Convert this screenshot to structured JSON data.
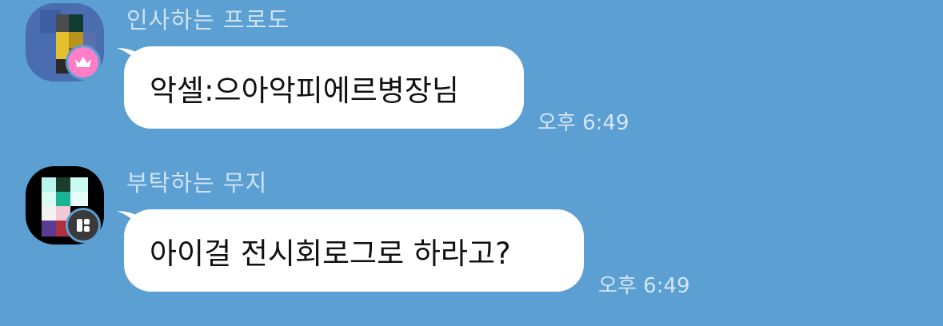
{
  "colors": {
    "background": "#5b9fd3",
    "bubble": "#ffffff",
    "crown_badge": "#ff7ec8",
    "app_badge": "#3a3a3a"
  },
  "messages": [
    {
      "sender": "인사하는 프로도",
      "text": "악셀:으아악피에르병장님",
      "time": "오후 6:49",
      "badge_icon": "crown-icon"
    },
    {
      "sender": "부탁하는 무지",
      "text": "아이걸 전시회로그로 하라고?",
      "time": "오후 6:49",
      "badge_icon": "grid-app-icon"
    }
  ]
}
